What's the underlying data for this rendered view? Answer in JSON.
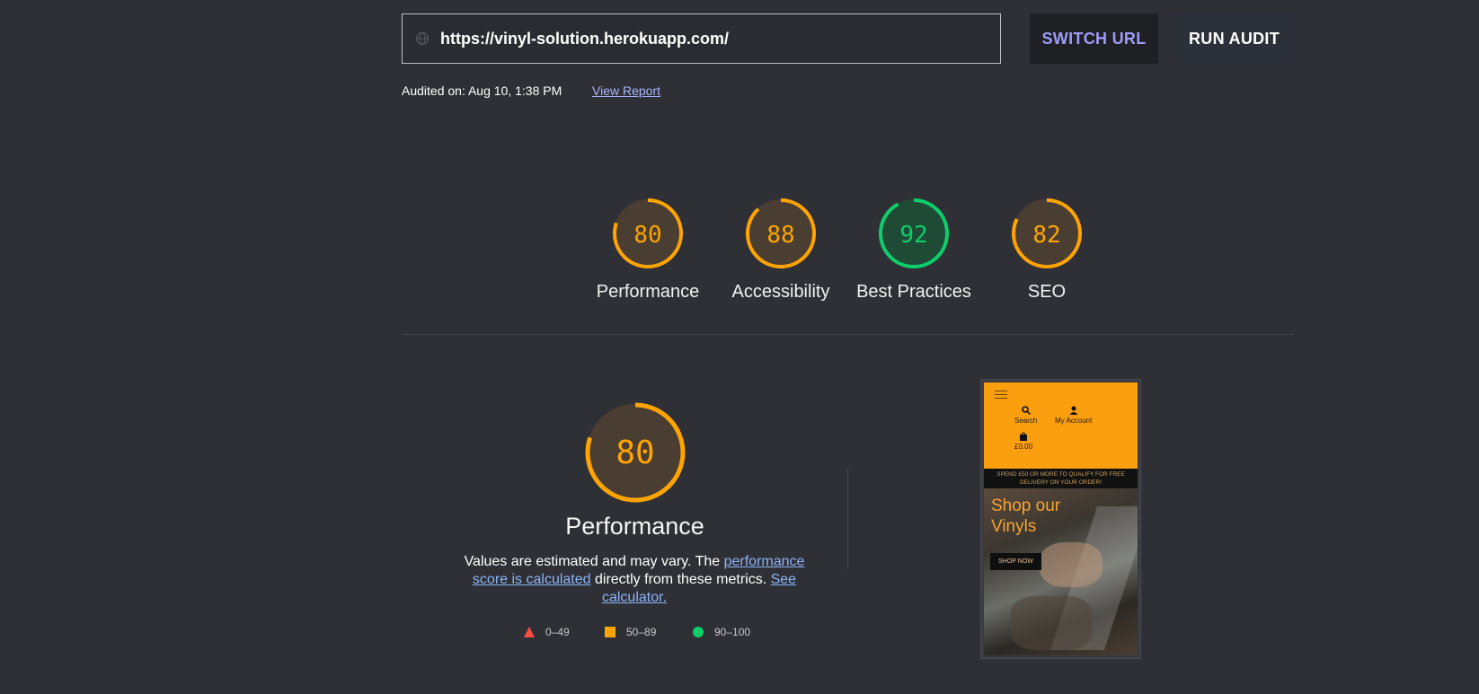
{
  "header": {
    "url_value": "https://vinyl-solution.herokuapp.com/",
    "switch_url_label": "SWITCH URL",
    "run_audit_label": "RUN AUDIT",
    "audited_on": "Audited on: Aug 10, 1:38 PM",
    "view_report_label": "View Report"
  },
  "scores": [
    {
      "label": "Performance",
      "value": "80",
      "color": "#ffa400"
    },
    {
      "label": "Accessibility",
      "value": "88",
      "color": "#ffa400"
    },
    {
      "label": "Best Practices",
      "value": "92",
      "color": "#0cce6b"
    },
    {
      "label": "SEO",
      "value": "82",
      "color": "#ffa400"
    }
  ],
  "detail": {
    "score": "80",
    "title": "Performance",
    "desc_part1": "Values are estimated and may vary. The ",
    "desc_link1": "performance score is calculated",
    "desc_part2": " directly from these metrics. ",
    "desc_link2": "See calculator.",
    "legend": [
      {
        "range": "0–49",
        "shape": "triangle",
        "color": "#ff4e42"
      },
      {
        "range": "50–89",
        "shape": "square",
        "color": "#ffa400"
      },
      {
        "range": "90–100",
        "shape": "circle",
        "color": "#0cce6b"
      }
    ]
  },
  "screenshot": {
    "search_label": "Search",
    "account_label": "My Account",
    "bag_label": "£0.00",
    "banner_text": "SPEND £50 OR MORE TO QUALIFY FOR FREE DELIVERY ON YOUR ORDER!",
    "hero_title": "Shop our Vinyls",
    "shop_button": "SHOP NOW"
  }
}
